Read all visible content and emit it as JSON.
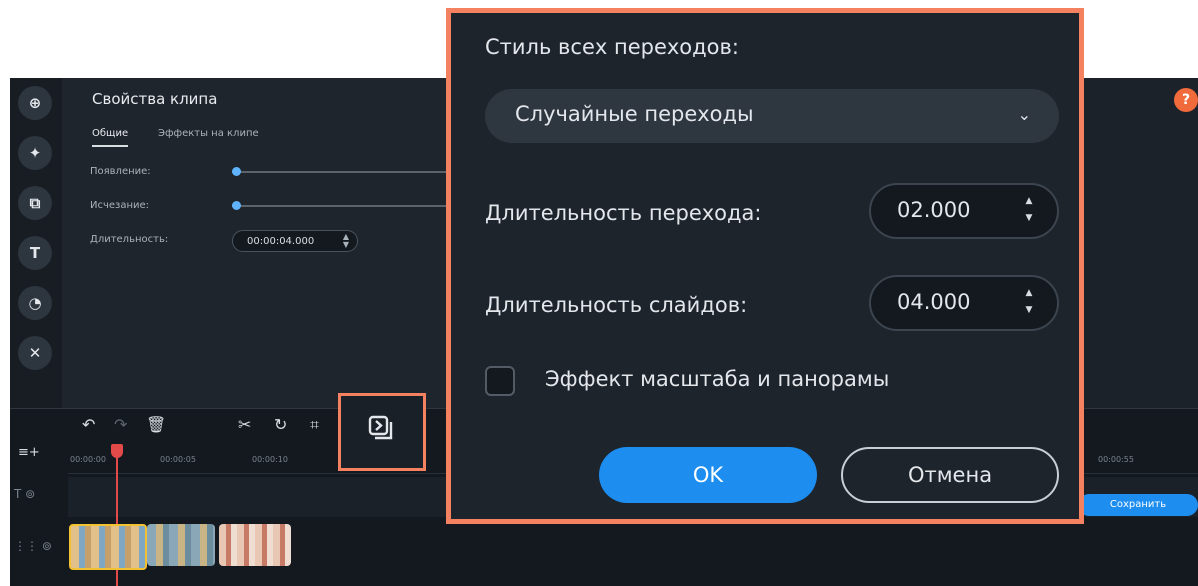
{
  "sidebar": {
    "icons": [
      "import-icon",
      "magic-wand-icon",
      "transitions-icon",
      "titles-icon",
      "stickers-icon",
      "tools-icon"
    ]
  },
  "clip_properties": {
    "title": "Свойства клипа",
    "tabs": [
      "Общие",
      "Эффекты на клипе"
    ],
    "appearance_label": "Появление:",
    "fade_label": "Исчезание:",
    "duration_label": "Длительность:",
    "duration_value": "00:00:04.000"
  },
  "help": {
    "label": "?"
  },
  "timeline": {
    "ruler_ticks": [
      "00:00:00",
      "00:00:05",
      "00:00:10",
      "00:00:55"
    ],
    "save_label": "Сохранить"
  },
  "dialog": {
    "style_label": "Стиль всех переходов:",
    "style_value": "Случайные переходы",
    "transition_duration_label": "Длительность перехода:",
    "transition_duration_value": "02.000",
    "slide_duration_label": "Длительность слайдов:",
    "slide_duration_value": "04.000",
    "zoom_pan_label": "Эффект масштаба и панорамы",
    "zoom_pan_checked": false,
    "ok_label": "OK",
    "cancel_label": "Отмена"
  },
  "colors": {
    "accent": "#1d8ef0",
    "highlight": "#f4815f",
    "playhead": "#e24a4a"
  }
}
